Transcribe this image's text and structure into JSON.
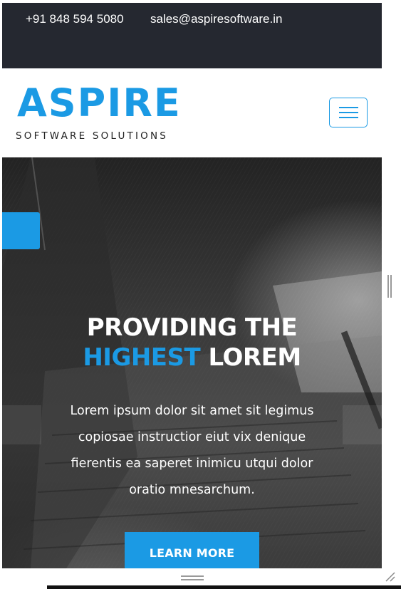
{
  "topbar": {
    "phone": "+91 848 594 5080",
    "email": "sales@aspiresoftware.in"
  },
  "header": {
    "logo_main": "ASPIRE",
    "logo_sub": "SOFTWARE SOLUTIONS",
    "menu_icon": "hamburger-icon"
  },
  "hero": {
    "headline_line1": "PROVIDING THE",
    "headline_highlight": "HIGHEST",
    "headline_rest": " LOREM",
    "body": "Lorem ipsum dolor sit amet sit legimus copiosae instructior eiut vix denique fierentis ea saperet inimicu utqui dolor oratio mnesarchum.",
    "cta_label": "LEARN MORE"
  },
  "colors": {
    "accent": "#1b9ae4",
    "topbar_bg": "#252830",
    "hero_text": "#ffffff"
  }
}
